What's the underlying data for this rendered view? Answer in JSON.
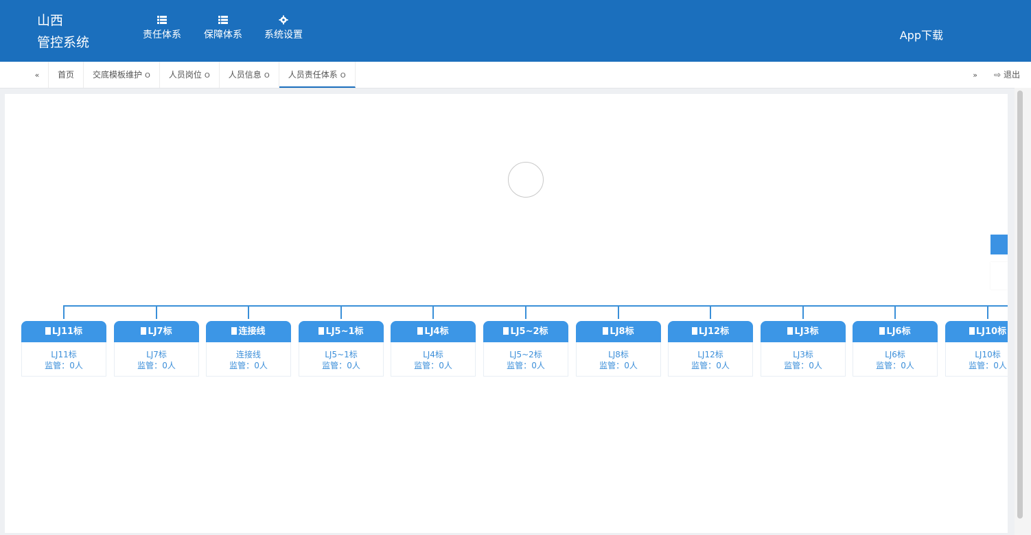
{
  "header": {
    "logo_line1": "山西",
    "logo_line2": "管控系统",
    "nav": [
      {
        "label": "责任体系",
        "icon": "list-icon"
      },
      {
        "label": "保障体系",
        "icon": "list-icon"
      },
      {
        "label": "系统设置",
        "icon": "gear-icon"
      }
    ],
    "app_download": "App下载",
    "bg_color": "#1b6fbd"
  },
  "tabbar": {
    "prev_icon": "«",
    "next_icon": "»",
    "close_glyph": "O",
    "tabs": [
      {
        "label": "首页"
      },
      {
        "label": "交底模板维护"
      },
      {
        "label": "人员岗位"
      },
      {
        "label": "人员信息"
      },
      {
        "label": "人员责任体系"
      }
    ],
    "logout": "退出",
    "logout_icon": "⇨"
  },
  "orgchart": {
    "node_color": "#3c96e6",
    "line_color": "#3a8fd8",
    "supervisor_prefix": "监管：",
    "nodes": [
      {
        "title": "LJ11标",
        "name": "LJ11标",
        "count": "0人"
      },
      {
        "title": "LJ7标",
        "name": "LJ7标",
        "count": "0人"
      },
      {
        "title": "连接线",
        "name": "连接线",
        "count": "0人"
      },
      {
        "title": "LJ5~1标",
        "name": "LJ5~1标",
        "count": "0人"
      },
      {
        "title": "LJ4标",
        "name": "LJ4标",
        "count": "0人"
      },
      {
        "title": "LJ5~2标",
        "name": "LJ5~2标",
        "count": "0人"
      },
      {
        "title": "LJ8标",
        "name": "LJ8标",
        "count": "0人"
      },
      {
        "title": "LJ12标",
        "name": "LJ12标",
        "count": "0人"
      },
      {
        "title": "LJ3标",
        "name": "LJ3标",
        "count": "0人"
      },
      {
        "title": "LJ6标",
        "name": "LJ6标",
        "count": "0人"
      },
      {
        "title": "LJ10标",
        "name": "LJ10标",
        "count": "0人"
      }
    ]
  }
}
